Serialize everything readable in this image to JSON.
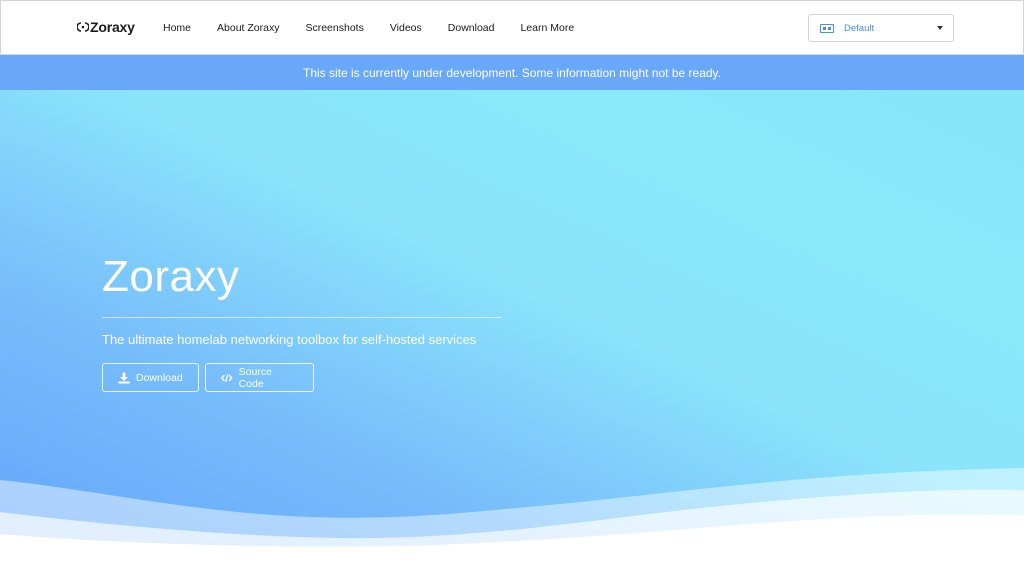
{
  "brand": {
    "name": "Zoraxy"
  },
  "nav": {
    "items": [
      {
        "label": "Home"
      },
      {
        "label": "About Zoraxy"
      },
      {
        "label": "Screenshots"
      },
      {
        "label": "Videos"
      },
      {
        "label": "Download"
      },
      {
        "label": "Learn More"
      }
    ]
  },
  "language_selector": {
    "icon": "translate-icon",
    "value": "Default"
  },
  "notice": {
    "text": "This site is currently under development. Some information might not be ready."
  },
  "hero": {
    "title": "Zoraxy",
    "subtitle": "The ultimate homelab networking toolbox for self-hosted services",
    "buttons": {
      "download": {
        "label": "Download",
        "icon": "download-icon"
      },
      "source": {
        "label": "Source Code",
        "icon": "code-icon"
      }
    }
  },
  "colors": {
    "notice_bg": "#69a8f9",
    "hero_gradient_start": "#62a4fb",
    "hero_gradient_end": "#8ae8fb",
    "accent": "#4a90d9"
  }
}
